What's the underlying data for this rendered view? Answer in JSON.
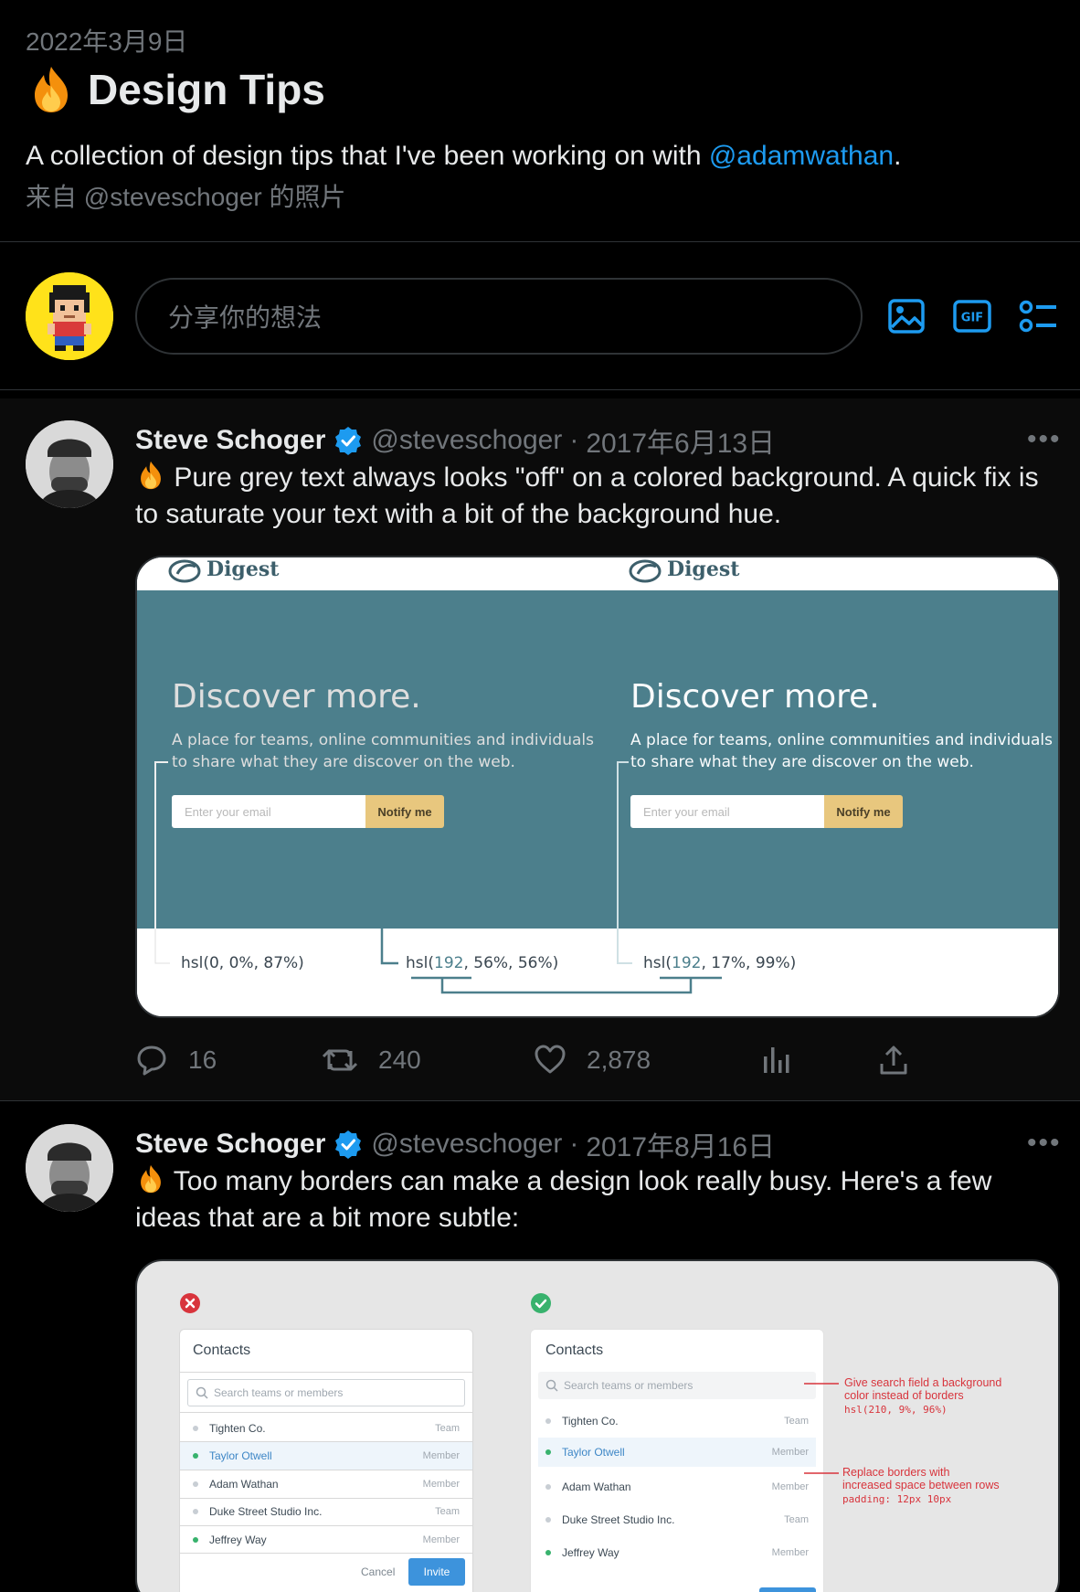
{
  "list": {
    "date": "2022年3月9日",
    "title": "Design Tips",
    "description_text": "A collection of design tips that I've been working on with ",
    "description_mention": "@adamwathan",
    "description_end": ".",
    "credit": "来自 @steveschoger 的照片"
  },
  "compose": {
    "placeholder": "分享你的想法",
    "icons": [
      "image-icon",
      "gif-icon",
      "poll-icon"
    ]
  },
  "tweets": [
    {
      "name": "Steve Schoger",
      "handle": "@steveschoger",
      "separator": "·",
      "date": "2017年6月13日",
      "text": "Pure grey text always looks \"off\" on a colored background. A quick fix is to saturate your text with a bit of the background hue.",
      "more": "•••",
      "media": {
        "logo": "Digest",
        "headline": "Discover more.",
        "paragraph_line1": "A place for teams, online communities and individuals",
        "paragraph_line2": "to share what they are discover on the web.",
        "email_placeholder": "Enter your email",
        "button": "Notify me",
        "label_grey": "hsl(0, 0%, 87%)",
        "label_bg_pre": "hsl(",
        "label_bg_hue": "192",
        "label_bg_post": ", 56%, 56%)",
        "label_text_pre": "hsl(",
        "label_text_hue": "192",
        "label_text_post": ", 17%, 99%)"
      },
      "stats": {
        "replies": "16",
        "retweets": "240",
        "likes": "2,878"
      }
    },
    {
      "name": "Steve Schoger",
      "handle": "@steveschoger",
      "separator": "·",
      "date": "2017年8月16日",
      "text_line1": "Too many borders can make a design look really busy. Here's a few",
      "text_line2": "ideas that are a bit more subtle:",
      "more": "•••",
      "media": {
        "card_title": "Contacts",
        "search_placeholder": "Search teams or members",
        "rows": [
          {
            "name": "Tighten Co.",
            "role": "Team",
            "active": false
          },
          {
            "name": "Taylor Otwell",
            "role": "Member",
            "active": true
          },
          {
            "name": "Adam Wathan",
            "role": "Member",
            "active": false
          },
          {
            "name": "Duke Street Studio Inc.",
            "role": "Team",
            "active": false
          },
          {
            "name": "Jeffrey Way",
            "role": "Member",
            "active": true
          }
        ],
        "cancel": "Cancel",
        "invite": "Invite",
        "note1_line1": "Give search field a background",
        "note1_line2": "color instead of borders",
        "note1_code": "hsl(210, 9%, 96%)",
        "note2_line1": "Replace borders with",
        "note2_line2": "increased space between rows",
        "note2_code": "padding: 12px 10px"
      }
    }
  ],
  "colors": {
    "accent": "#1d9bf0",
    "muted": "#71767b",
    "digest_panel": "#4c7f8c",
    "notify_button": "#e8c77e"
  }
}
